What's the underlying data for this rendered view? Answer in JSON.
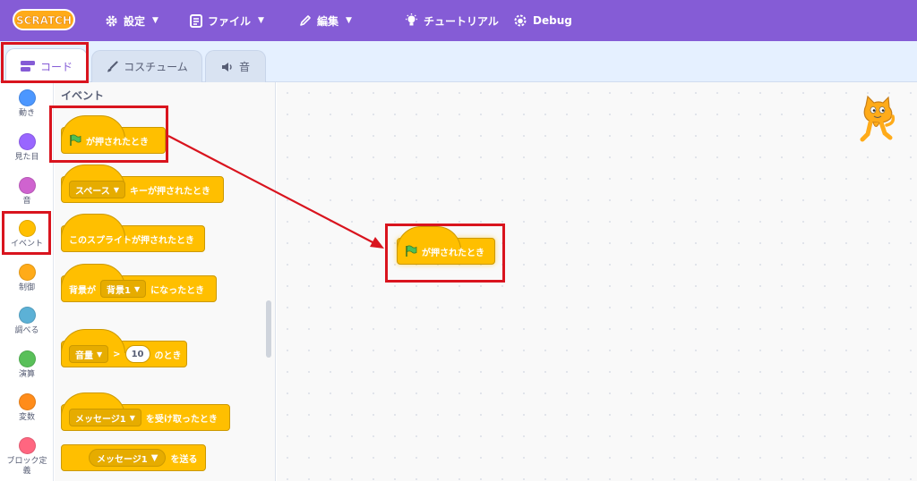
{
  "menubar": {
    "logo_text": "SCRATCH",
    "settings_label": "設定",
    "file_label": "ファイル",
    "edit_label": "編集",
    "tutorials_label": "チュートリアル",
    "debug_label": "Debug"
  },
  "tabs": {
    "code": "コード",
    "costumes": "コスチューム",
    "sounds": "音"
  },
  "categories": [
    {
      "label": "動き",
      "color": "#4C97FF"
    },
    {
      "label": "見た目",
      "color": "#9966FF"
    },
    {
      "label": "音",
      "color": "#CF63CF"
    },
    {
      "label": "イベント",
      "color": "#FFBF00"
    },
    {
      "label": "制御",
      "color": "#FFAB19"
    },
    {
      "label": "調べる",
      "color": "#5CB1D6"
    },
    {
      "label": "演算",
      "color": "#59C059"
    },
    {
      "label": "変数",
      "color": "#FF8C1A"
    },
    {
      "label": "ブロック定義",
      "color": "#FF6680"
    }
  ],
  "palette": {
    "title": "イベント",
    "flag_clicked": "が押されたとき",
    "key_dropdown": "スペース",
    "key_pressed": "キーが押されたとき",
    "sprite_clicked": "このスプライトが押されたとき",
    "backdrop_prefix": "背景が",
    "backdrop_dropdown": "背景1",
    "backdrop_suffix": "になったとき",
    "loudness_dropdown": "音量",
    "greater_than": ">",
    "loudness_value": "10",
    "loudness_suffix": "のとき",
    "message_dropdown": "メッセージ1",
    "receive_suffix": "を受け取ったとき",
    "broadcast_dropdown": "メッセージ1",
    "broadcast_suffix": "を送る"
  },
  "script_area": {
    "placed_block_label": "が押されたとき"
  },
  "colors": {
    "menubar": "#855CD6",
    "events_block": "#FFBF00",
    "annotation_red": "#D9141E"
  }
}
